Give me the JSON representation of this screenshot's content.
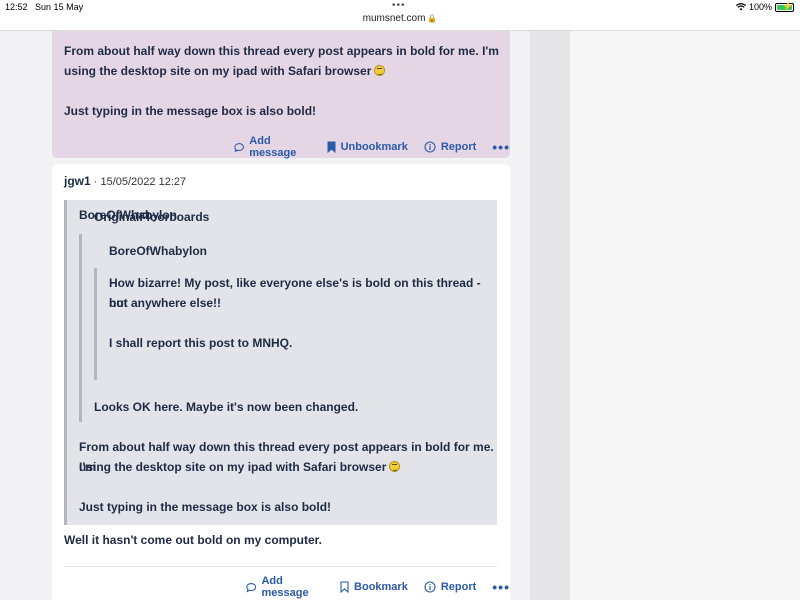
{
  "status_bar": {
    "time": "12:52",
    "date": "Sun 15 May",
    "battery_percent": "100%"
  },
  "browser": {
    "url": "mumsnet.com"
  },
  "post_previous": {
    "lines": [
      "From about half way down this thread every post appears in bold for me. I'm using the desktop site on my ipad with Safari browser",
      "Just typing in the message box is also bold!"
    ],
    "actions": {
      "add_message": "Add message",
      "bookmark": "Unbookmark",
      "report": "Report",
      "more": "•••"
    }
  },
  "post": {
    "author": "jgw1",
    "separator": "·",
    "timestamp": "15/05/2022 12:27",
    "quote": {
      "author": "BoreOfWhabylon",
      "nested": {
        "author": "OriginalFloorboards",
        "nested": {
          "author": "BoreOfWhabylon",
          "line1": "How bizarre! My post, like everyone else's is bold on this thread - but",
          "line2": "not anywhere else!!",
          "line3": "I shall report this post to MNHQ."
        },
        "text": "Looks OK here. Maybe it's now been changed."
      },
      "text_line1": "From about half way down this thread every post appears in bold for me. I'm",
      "text_line2": "using the desktop site on my ipad with Safari browser",
      "text_line3": "Just typing in the message box is also bold!"
    },
    "body": "Well it hasn't come out bold on my computer.",
    "actions": {
      "add_message": "Add message",
      "bookmark": "Bookmark",
      "report": "Report",
      "more": "•••"
    }
  },
  "colors": {
    "link": "#2b5aa8",
    "highlight_post": "#e5d6e6",
    "quote_bg": "#e3e4e9",
    "text": "#1f2a44"
  }
}
